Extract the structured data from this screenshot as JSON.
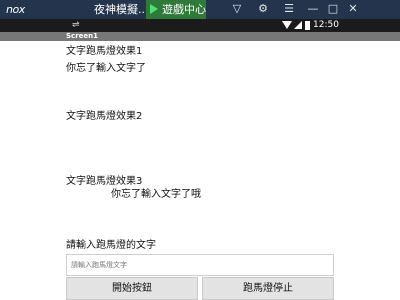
{
  "emulator": {
    "logo": "nox",
    "app_name": "夜神模擬...",
    "game_center_label": "遊戲中心",
    "icons": [
      "shirt-icon",
      "menu-icon",
      "settings-icon",
      "minimize-icon",
      "maximize-icon",
      "close-icon"
    ]
  },
  "status_bar": {
    "time": "12:50",
    "icons": [
      "usb-icon",
      "wifi-icon",
      "signal-icon",
      "battery-icon"
    ]
  },
  "app": {
    "title": "Screen1",
    "marquee1_label": "文字跑馬燈效果1",
    "marquee1_text": "你忘了輸入文字了",
    "marquee2_label": "文字跑馬燈效果2",
    "marquee2_text": "",
    "marquee3_label": "文字跑馬燈效果3",
    "marquee3_text": "你忘了輸入文字了哦",
    "input_prompt": "請輸入跑馬燈的文字",
    "input": {
      "value": "",
      "placeholder": "請輸入跑馬燈文字"
    },
    "start_button": "開始按鈕",
    "stop_button": "跑馬燈停止"
  }
}
